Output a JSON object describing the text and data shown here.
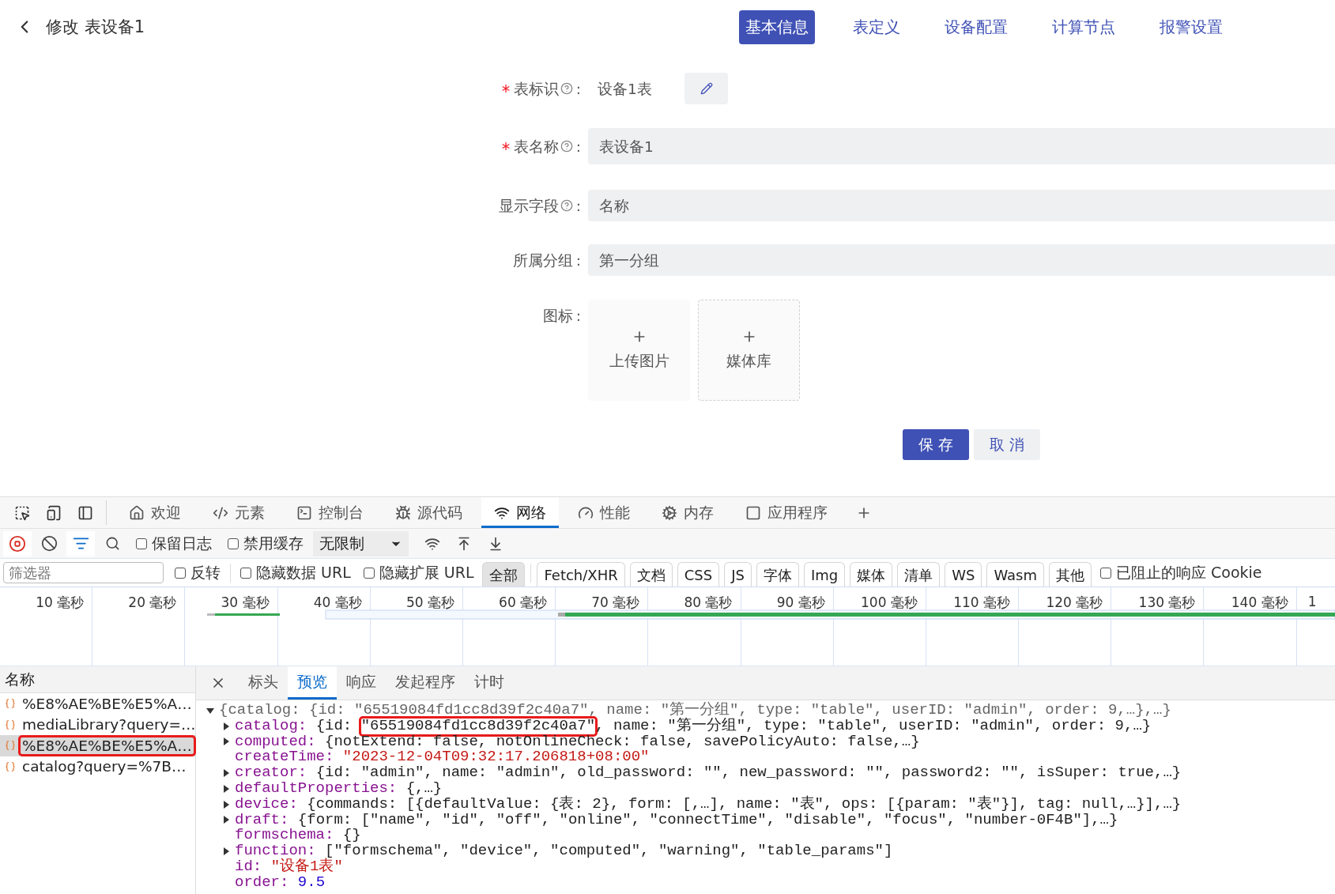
{
  "header": {
    "title": "修改 表设备1"
  },
  "tabs": [
    {
      "label": "基本信息",
      "selected": true
    },
    {
      "label": "表定义",
      "selected": false
    },
    {
      "label": "设备配置",
      "selected": false
    },
    {
      "label": "计算节点",
      "selected": false
    },
    {
      "label": "报警设置",
      "selected": false
    }
  ],
  "fields": [
    {
      "label": "表标识",
      "colon": ":",
      "required": true,
      "help": true,
      "kind": "text",
      "value": "设备1表"
    },
    {
      "label": "表名称",
      "colon": ":",
      "required": true,
      "help": true,
      "kind": "input",
      "value": "表设备1"
    },
    {
      "label": "显示字段",
      "colon": ":",
      "required": false,
      "help": true,
      "kind": "input",
      "value": "名称"
    },
    {
      "label": "所属分组",
      "colon": ":",
      "required": false,
      "help": false,
      "kind": "input",
      "value": "第一分组"
    }
  ],
  "icon_field": {
    "label": "图标",
    "colon": ":",
    "tiles": [
      {
        "label": "上传图片",
        "dashed": false
      },
      {
        "label": "媒体库",
        "dashed": true
      }
    ]
  },
  "actions": [
    {
      "label": "保 存",
      "primary": true
    },
    {
      "label": "取 消",
      "primary": false
    }
  ],
  "devtools": {
    "tabs": [
      {
        "label": "欢迎",
        "selected": false
      },
      {
        "label": "元素",
        "selected": false
      },
      {
        "label": "控制台",
        "selected": false
      },
      {
        "label": "源代码",
        "selected": false
      },
      {
        "label": "网络",
        "selected": true
      },
      {
        "label": "性能",
        "selected": false
      },
      {
        "label": "内存",
        "selected": false
      },
      {
        "label": "应用程序",
        "selected": false
      }
    ],
    "toolbar": {
      "recording": true,
      "checkboxes": [
        {
          "label": "保留日志",
          "checked": false
        },
        {
          "label": "禁用缓存",
          "checked": false
        }
      ],
      "throttle": "无限制"
    },
    "filter": {
      "placeholder": "筛选器",
      "checkboxes": [
        {
          "label": "反转",
          "checked": false
        },
        {
          "label": "隐藏数据 URL",
          "checked": false
        },
        {
          "label": "隐藏扩展 URL",
          "checked": false
        }
      ],
      "types": [
        {
          "label": "全部",
          "selected": true
        },
        {
          "label": "Fetch/XHR",
          "selected": false
        },
        {
          "label": "文档",
          "selected": false
        },
        {
          "label": "CSS",
          "selected": false
        },
        {
          "label": "JS",
          "selected": false
        },
        {
          "label": "字体",
          "selected": false
        },
        {
          "label": "Img",
          "selected": false
        },
        {
          "label": "媒体",
          "selected": false
        },
        {
          "label": "清单",
          "selected": false
        },
        {
          "label": "WS",
          "selected": false
        },
        {
          "label": "Wasm",
          "selected": false
        },
        {
          "label": "其他",
          "selected": false
        }
      ],
      "cookie": {
        "label": "已阻止的响应 Cookie",
        "checked": false
      }
    },
    "ticks": [
      "10 毫秒",
      "20 毫秒",
      "30 毫秒",
      "40 毫秒",
      "50 毫秒",
      "60 毫秒",
      "70 毫秒",
      "80 毫秒",
      "90 毫秒",
      "100 毫秒",
      "110 毫秒",
      "120 毫秒",
      "130 毫秒",
      "140 毫秒",
      "1"
    ],
    "requests": {
      "heading": "名称",
      "items": [
        {
          "name": "%E8%AE%BE%E5%A…",
          "selected": false,
          "annotated": false
        },
        {
          "name": "mediaLibrary?query=…",
          "selected": false,
          "annotated": false
        },
        {
          "name": "%E8%AE%BE%E5%A…",
          "selected": true,
          "annotated": true
        },
        {
          "name": "catalog?query=%7B…",
          "selected": false,
          "annotated": false
        }
      ]
    },
    "detail_tabs": [
      {
        "label": "标头",
        "selected": false
      },
      {
        "label": "预览",
        "selected": true
      },
      {
        "label": "响应",
        "selected": false
      },
      {
        "label": "发起程序",
        "selected": false
      },
      {
        "label": "计时",
        "selected": false
      }
    ],
    "preview": {
      "summary": "{catalog: {id: \"65519084fd1cc8d39f2c40a7\", name: \"第一分组\", type: \"table\", userID: \"admin\", order: 9,…},…}",
      "expanded": true,
      "children": [
        {
          "key": "catalog:",
          "kind": "collapsed",
          "parts": [
            {
              "text": "{id: ",
              "highlighted": false
            },
            {
              "text": "\"65519084fd1cc8d39f2c40a7\"",
              "highlighted": true
            },
            {
              "text": ", name: \"第一分组\", type: \"table\", userID: \"admin\", order: 9,…}",
              "highlighted": false
            }
          ]
        },
        {
          "key": "computed:",
          "kind": "collapsed",
          "parts": [
            {
              "text": "{notExtend: false, notOnlineCheck: false, savePolicyAuto: false,…}",
              "highlighted": false
            }
          ]
        },
        {
          "key": "createTime:",
          "kind": "string",
          "parts": [
            {
              "text": "\"2023-12-04T09:32:17.206818+08:00\"",
              "highlighted": false
            }
          ]
        },
        {
          "key": "creator:",
          "kind": "collapsed",
          "parts": [
            {
              "text": "{id: \"admin\", name: \"admin\", old_password: \"\", new_password: \"\", password2: \"\", isSuper: true,…}",
              "highlighted": false
            }
          ]
        },
        {
          "key": "defaultProperties:",
          "kind": "collapsed",
          "parts": [
            {
              "text": "{,…}",
              "highlighted": false
            }
          ]
        },
        {
          "key": "device:",
          "kind": "collapsed",
          "parts": [
            {
              "text": "{commands: [{defaultValue: {表: 2}, form: [,…], name: \"表\", ops: [{param: \"表\"}], tag: null,…}],…}",
              "highlighted": false
            }
          ]
        },
        {
          "key": "draft:",
          "kind": "collapsed",
          "parts": [
            {
              "text": "{form: [\"name\", \"id\", \"off\", \"online\", \"connectTime\", \"disable\", \"focus\", \"number-0F4B\"],…}",
              "highlighted": false
            }
          ]
        },
        {
          "key": "formschema:",
          "kind": "plain",
          "parts": [
            {
              "text": "{}",
              "highlighted": false
            }
          ]
        },
        {
          "key": "function:",
          "kind": "collapsed",
          "parts": [
            {
              "text": "[\"formschema\", \"device\", \"computed\", \"warning\", \"table_params\"]",
              "highlighted": false
            }
          ]
        },
        {
          "key": "id:",
          "kind": "string",
          "parts": [
            {
              "text": "\"设备1表\"",
              "highlighted": false
            }
          ]
        },
        {
          "key": "order:",
          "kind": "number",
          "parts": [
            {
              "text": "9.5",
              "highlighted": false
            }
          ]
        }
      ]
    }
  }
}
